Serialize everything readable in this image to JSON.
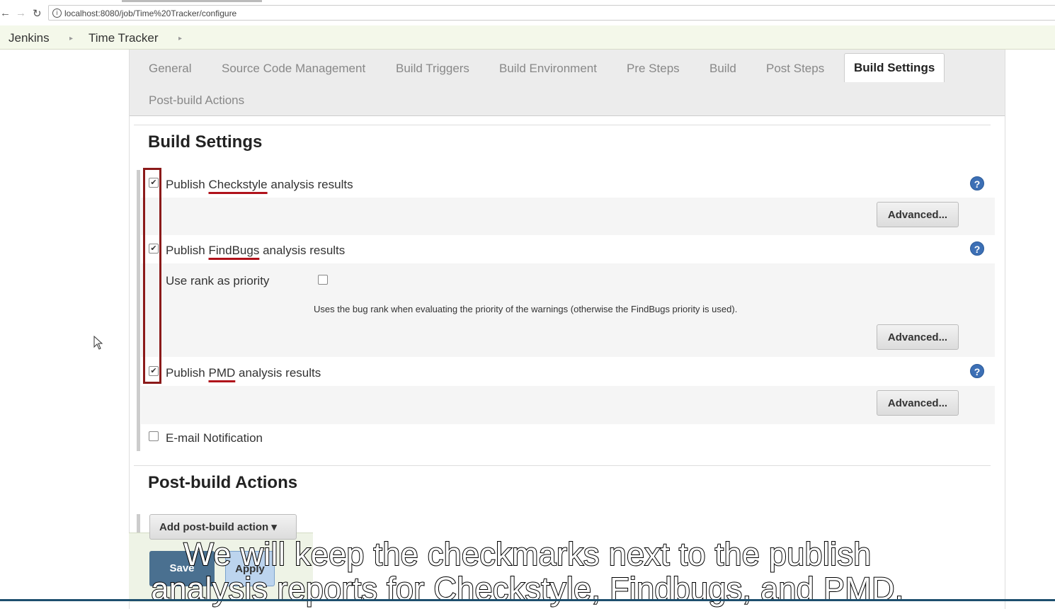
{
  "browser": {
    "url": "localhost:8080/job/Time%20Tracker/configure"
  },
  "breadcrumb": {
    "items": [
      "Jenkins",
      "Time Tracker"
    ],
    "sep": "▸"
  },
  "tabs": [
    {
      "label": "General"
    },
    {
      "label": "Source Code Management"
    },
    {
      "label": "Build Triggers"
    },
    {
      "label": "Build Environment"
    },
    {
      "label": "Pre Steps"
    },
    {
      "label": "Build"
    },
    {
      "label": "Post Steps"
    },
    {
      "label": "Build Settings",
      "active": true
    },
    {
      "label": "Post-build Actions"
    }
  ],
  "build_settings": {
    "title": "Build Settings",
    "checkstyle": {
      "prefix": "Publish",
      "tool": "Checkstyle",
      "suffix": "analysis results",
      "checked": true
    },
    "findbugs": {
      "prefix": "Publish",
      "tool": "FindBugs",
      "suffix": "analysis results",
      "checked": true
    },
    "use_rank": {
      "label": "Use rank as priority",
      "checked": false,
      "description": "Uses the bug rank when evaluating the priority of the warnings (otherwise the FindBugs priority is used)."
    },
    "pmd": {
      "prefix": "Publish",
      "tool": "PMD",
      "suffix": "analysis results",
      "checked": true
    },
    "email": {
      "label": "E-mail Notification",
      "checked": false
    },
    "advanced_label": "Advanced...",
    "help_glyph": "?",
    "check_glyph": "✔"
  },
  "post_build": {
    "title": "Post-build Actions",
    "add_label": "Add post-build action",
    "add_caret": "▾"
  },
  "footer": {
    "save_label": "Save",
    "apply_label": "Apply"
  },
  "caption": {
    "line1": "We will keep the checkmarks next to the publish",
    "line2": "analysis reports for Checkstyle, Findbugs, and PMD."
  },
  "colors": {
    "breadcrumb_bg": "#f4f8ea",
    "highlight": "#8b1a1a",
    "help_icon": "#3c6fb5",
    "save_button": "#4a7090"
  }
}
